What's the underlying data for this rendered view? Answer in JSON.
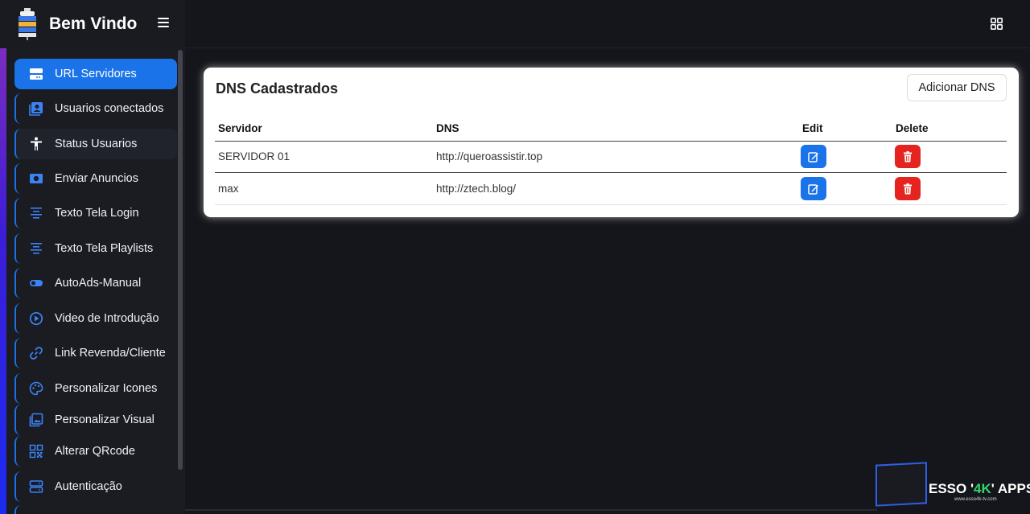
{
  "header": {
    "title": "Bem Vindo"
  },
  "sidebar": {
    "items": [
      {
        "label": "URL Servidores",
        "icon": "server-icon",
        "active": true
      },
      {
        "label": "Usuarios conectados",
        "icon": "contacts-icon"
      },
      {
        "label": "Status Usuarios",
        "icon": "person-icon"
      },
      {
        "label": "Enviar Anuncios",
        "icon": "money-icon"
      },
      {
        "label": "Texto Tela Login",
        "icon": "text-icon"
      },
      {
        "label": "Texto Tela Playlists",
        "icon": "text-icon"
      },
      {
        "label": "AutoAds-Manual",
        "icon": "toggle-icon"
      },
      {
        "label": "Video de Introdução",
        "icon": "play-icon"
      },
      {
        "label": "Link Revenda/Cliente",
        "icon": "link-icon"
      },
      {
        "label": "Personalizar Icones",
        "icon": "palette-icon"
      },
      {
        "label": "Personalizar Visual",
        "icon": "image-icon"
      },
      {
        "label": "Alterar QRcode",
        "icon": "qrcode-icon"
      },
      {
        "label": "Autenticação",
        "icon": "storage-icon"
      }
    ]
  },
  "card": {
    "title": "DNS Cadastrados",
    "add_button": "Adicionar DNS",
    "columns": [
      "Servidor",
      "DNS",
      "Edit",
      "Delete"
    ],
    "rows": [
      {
        "servidor": "SERVIDOR 01",
        "dns": "http://queroassistir.top"
      },
      {
        "servidor": "max",
        "dns": "http://ztech.blog/"
      }
    ]
  },
  "watermark": {
    "brand_a": "ESSO '",
    "brand_b": "4K",
    "brand_c": "' APPS",
    "url": "www.esso4k-tv.com"
  },
  "colors": {
    "accent": "#1a73e8",
    "danger": "#e52420",
    "background": "#15161b",
    "sidebar": "#1b1c22"
  }
}
